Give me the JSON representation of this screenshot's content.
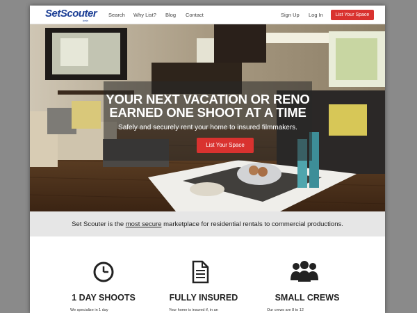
{
  "nav": {
    "logo": "SetScouter",
    "logo_sub": "beta",
    "links": [
      "Search",
      "Why List?",
      "Blog",
      "Contact"
    ],
    "signup": "Sign Up",
    "login": "Log In",
    "cta": "List Your Space"
  },
  "hero": {
    "title_line1": "YOUR NEXT VACATION OR RENO",
    "title_line2": "EARNED ONE SHOOT AT A TIME",
    "subtitle": "Safely and securely rent your home to insured filmmakers.",
    "button": "List Your Space"
  },
  "tagline": {
    "before": "Set Scouter is the ",
    "emphasis": "most secure",
    "after": " marketplace for residential rentals to commercial productions."
  },
  "features": [
    {
      "icon": "clock-icon",
      "title": "1 DAY SHOOTS",
      "text": "We specialize in 1 day"
    },
    {
      "icon": "document-icon",
      "title": "FULLY INSURED",
      "text": "Your home is insured if, in an"
    },
    {
      "icon": "group-icon",
      "title": "SMALL CREWS",
      "text": "Our crews are 8 to 12"
    }
  ],
  "colors": {
    "brand": "#1c3f95",
    "accent": "#d9322f"
  }
}
